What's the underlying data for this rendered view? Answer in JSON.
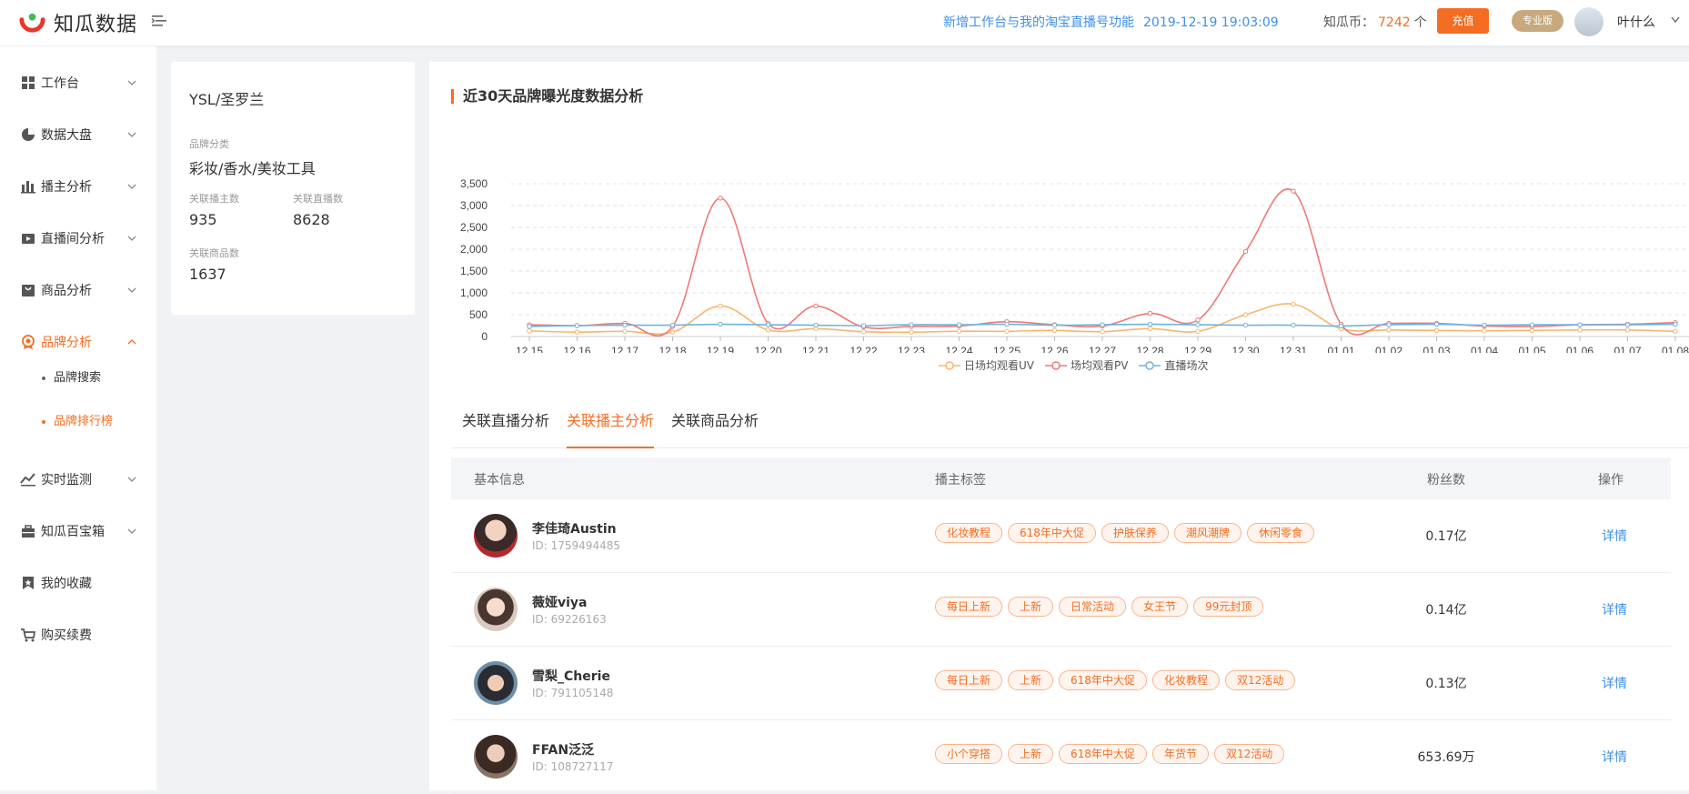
{
  "header": {
    "logo_text": "知瓜数据",
    "notice_text": "新增工作台与我的淘宝直播号功能",
    "notice_time": "2019-12-19 19:03:09",
    "coins_label": "知瓜币：",
    "coins_value": "7242",
    "coins_unit": "个",
    "recharge_label": "充值",
    "pro_label": "专业版",
    "username": "叶什么"
  },
  "sidebar": {
    "items": [
      {
        "label": "工作台",
        "icon": "grid-icon"
      },
      {
        "label": "数据大盘",
        "icon": "pie-icon"
      },
      {
        "label": "播主分析",
        "icon": "bar-icon"
      },
      {
        "label": "直播间分析",
        "icon": "video-icon"
      },
      {
        "label": "商品分析",
        "icon": "bag-icon"
      },
      {
        "label": "品牌分析",
        "icon": "badge-icon"
      },
      {
        "label": "实时监测",
        "icon": "trend-icon"
      },
      {
        "label": "知瓜百宝箱",
        "icon": "box-icon"
      },
      {
        "label": "我的收藏",
        "icon": "bookmark-icon"
      },
      {
        "label": "购买续费",
        "icon": "cart-icon"
      }
    ],
    "sub_items": [
      {
        "label": "品牌搜索"
      },
      {
        "label": "品牌排行榜"
      }
    ]
  },
  "brand": {
    "name": "YSL/圣罗兰",
    "category_label": "品牌分类",
    "category_value": "彩妆/香水/美妆工具",
    "streamers_label": "关联播主数",
    "streamers_value": "935",
    "lives_label": "关联直播数",
    "lives_value": "8628",
    "goods_label": "关联商品数",
    "goods_value": "1637"
  },
  "chart_title": "近30天品牌曝光度数据分析",
  "chart_data": {
    "type": "line",
    "x": [
      "12.15",
      "12.16",
      "12.17",
      "12.18",
      "12.19",
      "12.20",
      "12.21",
      "12.22",
      "12.23",
      "12.24",
      "12.25",
      "12.26",
      "12.27",
      "12.28",
      "12.29",
      "12.30",
      "12.31",
      "01.01",
      "01.02",
      "01.03",
      "01.04",
      "01.05",
      "01.06",
      "01.07",
      "01.08"
    ],
    "ylim": [
      0,
      3500
    ],
    "yticks": [
      "0",
      "500",
      "1,000",
      "1,500",
      "2,000",
      "2,500",
      "3,000",
      "3,500"
    ],
    "grid": true,
    "legend_position": "bottom",
    "series": [
      {
        "name": "日场均观看UV",
        "color": "#f9b56b",
        "values": [
          130,
          100,
          120,
          100,
          700,
          150,
          180,
          110,
          100,
          120,
          120,
          140,
          110,
          180,
          120,
          500,
          740,
          180,
          150,
          140,
          130,
          140,
          150,
          150,
          120
        ]
      },
      {
        "name": "场均观看PV",
        "color": "#ef7878",
        "values": [
          270,
          250,
          300,
          230,
          3170,
          300,
          700,
          220,
          230,
          240,
          340,
          270,
          240,
          530,
          380,
          1950,
          3330,
          280,
          300,
          300,
          240,
          230,
          270,
          280,
          320
        ]
      },
      {
        "name": "直播场次",
        "color": "#6fb3dc",
        "values": [
          230,
          250,
          260,
          260,
          280,
          270,
          260,
          250,
          270,
          270,
          280,
          260,
          270,
          280,
          270,
          260,
          260,
          240,
          270,
          280,
          260,
          270,
          270,
          270,
          280
        ]
      }
    ]
  },
  "tabs": [
    {
      "label": "关联直播分析"
    },
    {
      "label": "关联播主分析"
    },
    {
      "label": "关联商品分析"
    }
  ],
  "table": {
    "headers": [
      "基本信息",
      "播主标签",
      "粉丝数",
      "操作"
    ],
    "rows": [
      {
        "name": "李佳琦Austin",
        "id": "ID:  1759494485",
        "tags": [
          "化妆教程",
          "618年中大促",
          "护肤保养",
          "潮风潮牌",
          "休闲零食"
        ],
        "fans": "0.17亿",
        "action": "详情"
      },
      {
        "name": "薇娅viya",
        "id": "ID:  69226163",
        "tags": [
          "每日上新",
          "上新",
          "日常活动",
          "女王节",
          "99元封顶"
        ],
        "fans": "0.14亿",
        "action": "详情"
      },
      {
        "name": "雪梨_Cherie",
        "id": "ID:  791105148",
        "tags": [
          "每日上新",
          "上新",
          "618年中大促",
          "化妆教程",
          "双12活动"
        ],
        "fans": "0.13亿",
        "action": "详情"
      },
      {
        "name": "FFAN泛泛",
        "id": "ID:  108727117",
        "tags": [
          "小个穿搭",
          "上新",
          "618年中大促",
          "年货节",
          "双12活动"
        ],
        "fans": "653.69万",
        "action": "详情"
      }
    ]
  }
}
